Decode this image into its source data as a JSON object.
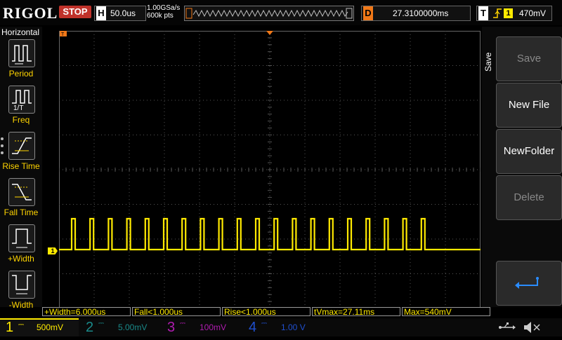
{
  "brand": "RIGOL",
  "run_status": "STOP",
  "horizontal": {
    "letter": "H",
    "timebase": "50.0us",
    "sample_rate": "1.00GSa/s",
    "memory_depth": "600k pts"
  },
  "delay": {
    "letter": "D",
    "value": "27.3100000ms"
  },
  "trigger": {
    "letter": "T",
    "edge_icon": "rising-edge-icon",
    "source": "1",
    "level": "470mV"
  },
  "left_menu": {
    "title": "Horizontal",
    "items": [
      {
        "label": "Period",
        "icon": "period-icon"
      },
      {
        "label": "Freq",
        "icon": "frequency-icon"
      },
      {
        "label": "Rise Time",
        "icon": "rise-time-icon"
      },
      {
        "label": "Fall Time",
        "icon": "fall-time-icon"
      },
      {
        "label": "+Width",
        "icon": "positive-width-icon"
      },
      {
        "label": "-Width",
        "icon": "negative-width-icon"
      }
    ]
  },
  "right_menu": {
    "title": "Save",
    "buttons": [
      {
        "label": "Save",
        "enabled": false
      },
      {
        "label": "New File",
        "enabled": true
      },
      {
        "label": "NewFolder",
        "enabled": true
      },
      {
        "label": "Delete",
        "enabled": false
      },
      {
        "label": "",
        "icon": "return-arrow-icon",
        "enabled": true
      }
    ]
  },
  "measurements": [
    "+Width=6.000us",
    "Fall<1.000us",
    "Rise<1.000us",
    "tVmax=27.11ms",
    "Max=540mV"
  ],
  "channels": [
    {
      "num": "1",
      "scale": "500mV",
      "color": "#ffea00",
      "active": true
    },
    {
      "num": "2",
      "scale": "5.00mV",
      "color": "#1a8a8a",
      "active": false
    },
    {
      "num": "3",
      "scale": "100mV",
      "color": "#b01cb0",
      "active": false
    },
    {
      "num": "4",
      "scale": "1.00 V",
      "color": "#2050d0",
      "active": false
    }
  ],
  "colors": {
    "ch1": "#ffea00",
    "trigger_marker": "#f07818",
    "grid": "#555555",
    "stop": "#c0322a"
  },
  "waveform": {
    "pulse_count": 20,
    "high": "540mV"
  }
}
